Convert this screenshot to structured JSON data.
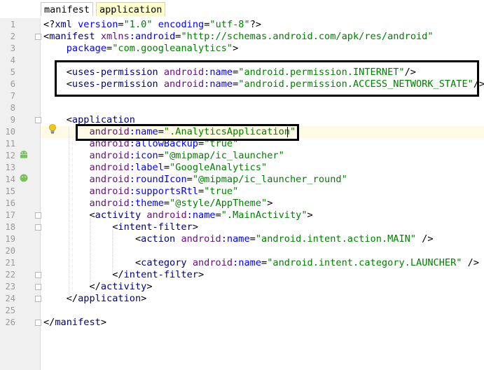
{
  "tabs": [
    {
      "label": "manifest"
    },
    {
      "label": "application"
    }
  ],
  "code": {
    "lines": [
      {
        "n": "1",
        "t": "<?xml version=\"1.0\" encoding=\"utf-8\"?>"
      },
      {
        "n": "2",
        "t": "<manifest xmlns:android=\"http://schemas.android.com/apk/res/android\""
      },
      {
        "n": "3",
        "t": "    package=\"com.googleanalytics\">"
      },
      {
        "n": "4",
        "t": ""
      },
      {
        "n": "5",
        "t": "    <uses-permission android:name=\"android.permission.INTERNET\"/>"
      },
      {
        "n": "6",
        "t": "    <uses-permission android:name=\"android.permission.ACCESS_NETWORK_STATE\"/>"
      },
      {
        "n": "7",
        "t": ""
      },
      {
        "n": "8",
        "t": ""
      },
      {
        "n": "9",
        "t": "    <application"
      },
      {
        "n": "10",
        "t": "        android:name=\".AnalyticsApplication\""
      },
      {
        "n": "11",
        "t": "        android:allowBackup=\"true\""
      },
      {
        "n": "12",
        "t": "        android:icon=\"@mipmap/ic_launcher\""
      },
      {
        "n": "13",
        "t": "        android:label=\"GoogleAnalytics\""
      },
      {
        "n": "14",
        "t": "        android:roundIcon=\"@mipmap/ic_launcher_round\""
      },
      {
        "n": "15",
        "t": "        android:supportsRtl=\"true\""
      },
      {
        "n": "16",
        "t": "        android:theme=\"@style/AppTheme\">"
      },
      {
        "n": "17",
        "t": "        <activity android:name=\".MainActivity\">"
      },
      {
        "n": "18",
        "t": "            <intent-filter>"
      },
      {
        "n": "19",
        "t": "                <action android:name=\"android.intent.action.MAIN\" />"
      },
      {
        "n": "20",
        "t": ""
      },
      {
        "n": "21",
        "t": "                <category android:name=\"android.intent.category.LAUNCHER\" />"
      },
      {
        "n": "22",
        "t": "            </intent-filter>"
      },
      {
        "n": "23",
        "t": "        </activity>"
      },
      {
        "n": "24",
        "t": "    </application>"
      },
      {
        "n": "25",
        "t": ""
      },
      {
        "n": "26",
        "t": "</manifest>"
      }
    ]
  },
  "icons": {
    "bulb": "lightbulb-icon",
    "android": "android-icon"
  },
  "colors": {
    "tag": "#000080",
    "attribute": "#0000ff",
    "namespace": "#660e7a",
    "string": "#008000",
    "gutter": "#f0f0f0",
    "current_line": "#fffae3",
    "active_tab": "#ffffcc"
  }
}
